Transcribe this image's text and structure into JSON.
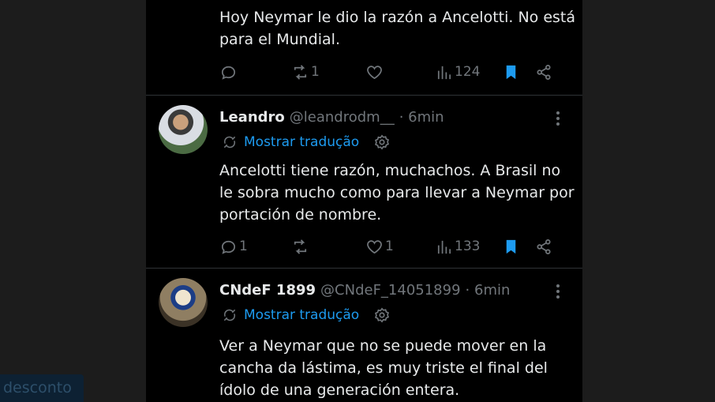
{
  "tweets": [
    {
      "text_lines": [
        "Hoy Neymar le dio la razón a Ancelotti. No está",
        "para el Mundial."
      ],
      "replies": "",
      "retweets": "1",
      "likes": "",
      "views": "124",
      "bookmarked": true
    },
    {
      "name": "Leandro",
      "handle": "@leandrodm__",
      "time": "· 6min",
      "translate_label": "Mostrar tradução",
      "text_lines": [
        "Ancelotti tiene razón, muchachos. A Brasil no",
        "le sobra mucho como para llevar a Neymar por",
        "portación de nombre."
      ],
      "replies": "1",
      "retweets": "",
      "likes": "1",
      "views": "133",
      "bookmarked": true
    },
    {
      "name": "CNdeF 1899",
      "handle": "@CNdeF_14051899",
      "time": "· 6min",
      "translate_label": "Mostrar tradução",
      "text_lines": [
        "Ver a Neymar que no se puede mover en la",
        "cancha da lástima, es muy triste el final del",
        "ídolo de una generación entera."
      ]
    }
  ],
  "overlay_badge": "desconto",
  "colors": {
    "accent": "#1d9bf0",
    "muted": "#71767b",
    "text": "#e7e9ea",
    "background": "#000000"
  },
  "icons": [
    "reply-icon",
    "retweet-icon",
    "like-icon",
    "views-icon",
    "bookmark-icon",
    "share-icon",
    "translate-icon",
    "gear-icon",
    "more-icon"
  ]
}
